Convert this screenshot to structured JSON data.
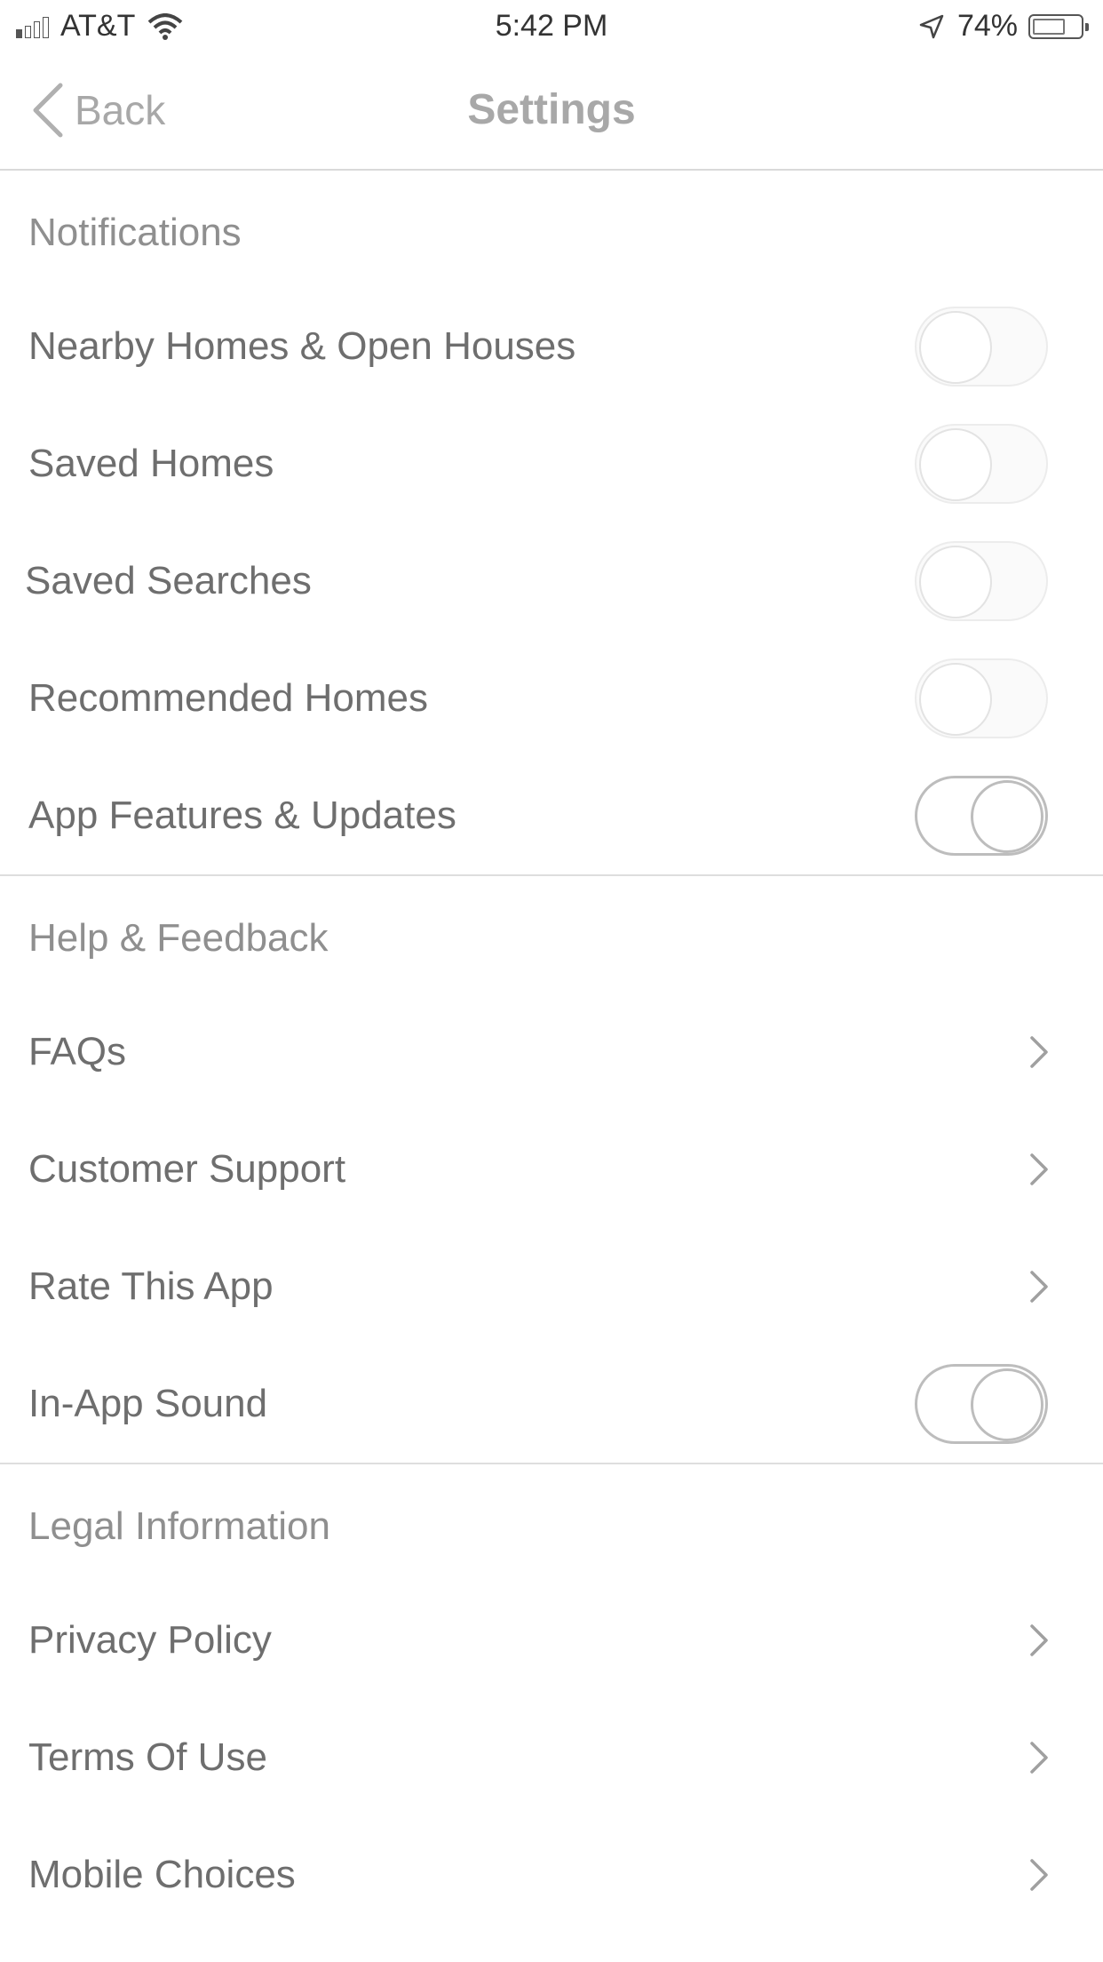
{
  "status_bar": {
    "carrier": "AT&T",
    "time": "5:42 PM",
    "battery_percent": "74%",
    "icons": [
      "signal-icon",
      "wifi-icon",
      "location-arrow-icon",
      "battery-icon"
    ]
  },
  "nav": {
    "back_label": "Back",
    "title": "Settings"
  },
  "sections": [
    {
      "header": "Notifications",
      "rows": [
        {
          "label": "Nearby Homes & Open Houses",
          "type": "toggle",
          "on": false
        },
        {
          "label": "Saved Homes",
          "type": "toggle",
          "on": false
        },
        {
          "label": "Saved Searches",
          "type": "toggle",
          "on": false
        },
        {
          "label": "Recommended Homes",
          "type": "toggle",
          "on": false
        },
        {
          "label": "App Features & Updates",
          "type": "toggle",
          "on": true
        }
      ]
    },
    {
      "header": "Help & Feedback",
      "rows": [
        {
          "label": "FAQs",
          "type": "link"
        },
        {
          "label": "Customer Support",
          "type": "link"
        },
        {
          "label": "Rate This App",
          "type": "link"
        },
        {
          "label": "In-App Sound",
          "type": "toggle",
          "on": true
        }
      ]
    },
    {
      "header": "Legal Information",
      "rows": [
        {
          "label": "Privacy Policy",
          "type": "link"
        },
        {
          "label": "Terms Of Use",
          "type": "link"
        },
        {
          "label": "Mobile Choices",
          "type": "link"
        }
      ]
    }
  ]
}
